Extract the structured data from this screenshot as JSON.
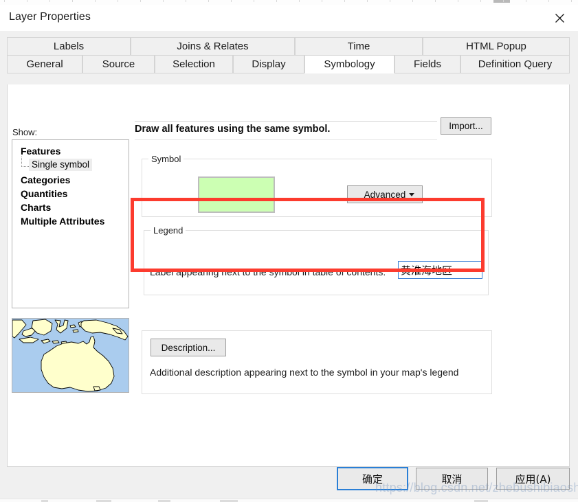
{
  "window": {
    "title": "Layer Properties",
    "close_icon": "close-icon"
  },
  "tabs": {
    "row1": [
      {
        "label": "Labels",
        "active": false
      },
      {
        "label": "Joins & Relates",
        "active": false
      },
      {
        "label": "Time",
        "active": false
      },
      {
        "label": "HTML Popup",
        "active": false
      }
    ],
    "row2": [
      {
        "label": "General",
        "active": false
      },
      {
        "label": "Source",
        "active": false
      },
      {
        "label": "Selection",
        "active": false
      },
      {
        "label": "Display",
        "active": false
      },
      {
        "label": "Symbology",
        "active": true
      },
      {
        "label": "Fields",
        "active": false
      },
      {
        "label": "Definition Query",
        "active": false
      }
    ]
  },
  "show": {
    "label": "Show:",
    "tree": [
      {
        "label": "Features",
        "level": 0,
        "selected": false
      },
      {
        "label": "Single symbol",
        "level": 1,
        "selected": true
      },
      {
        "label": "Categories",
        "level": 0,
        "selected": false
      },
      {
        "label": "Quantities",
        "level": 0,
        "selected": false
      },
      {
        "label": "Charts",
        "level": 0,
        "selected": false
      },
      {
        "label": "Multiple Attributes",
        "level": 0,
        "selected": false
      }
    ]
  },
  "preview": {
    "name": "map-thumbnail",
    "ocean_color": "#aaccee",
    "land_color": "#ffffcc",
    "outline_color": "#000000"
  },
  "main": {
    "draw_heading": "Draw all features using the same symbol.",
    "import_button": "Import...",
    "symbol_group_label": "Symbol",
    "symbol_swatch_color": "#ccffb3",
    "advanced_button": "Advanced",
    "advanced_mnemonic_index": 4,
    "legend_group_label": "Legend",
    "legend_prompt": "Label appearing next to the symbol in table of contents:",
    "legend_value": "黄淮海地区",
    "legend_placeholder": "",
    "description_button": "Description...",
    "description_text": "Additional description appearing next to the symbol in your map's legend"
  },
  "annotation": {
    "highlight_color": "#fc3b2e"
  },
  "footer": {
    "ok": "确定",
    "cancel": "取消",
    "apply": "应用(A)"
  },
  "watermark": {
    "text": "https://blog.csdn.net/zhebushibiaoshifu"
  }
}
